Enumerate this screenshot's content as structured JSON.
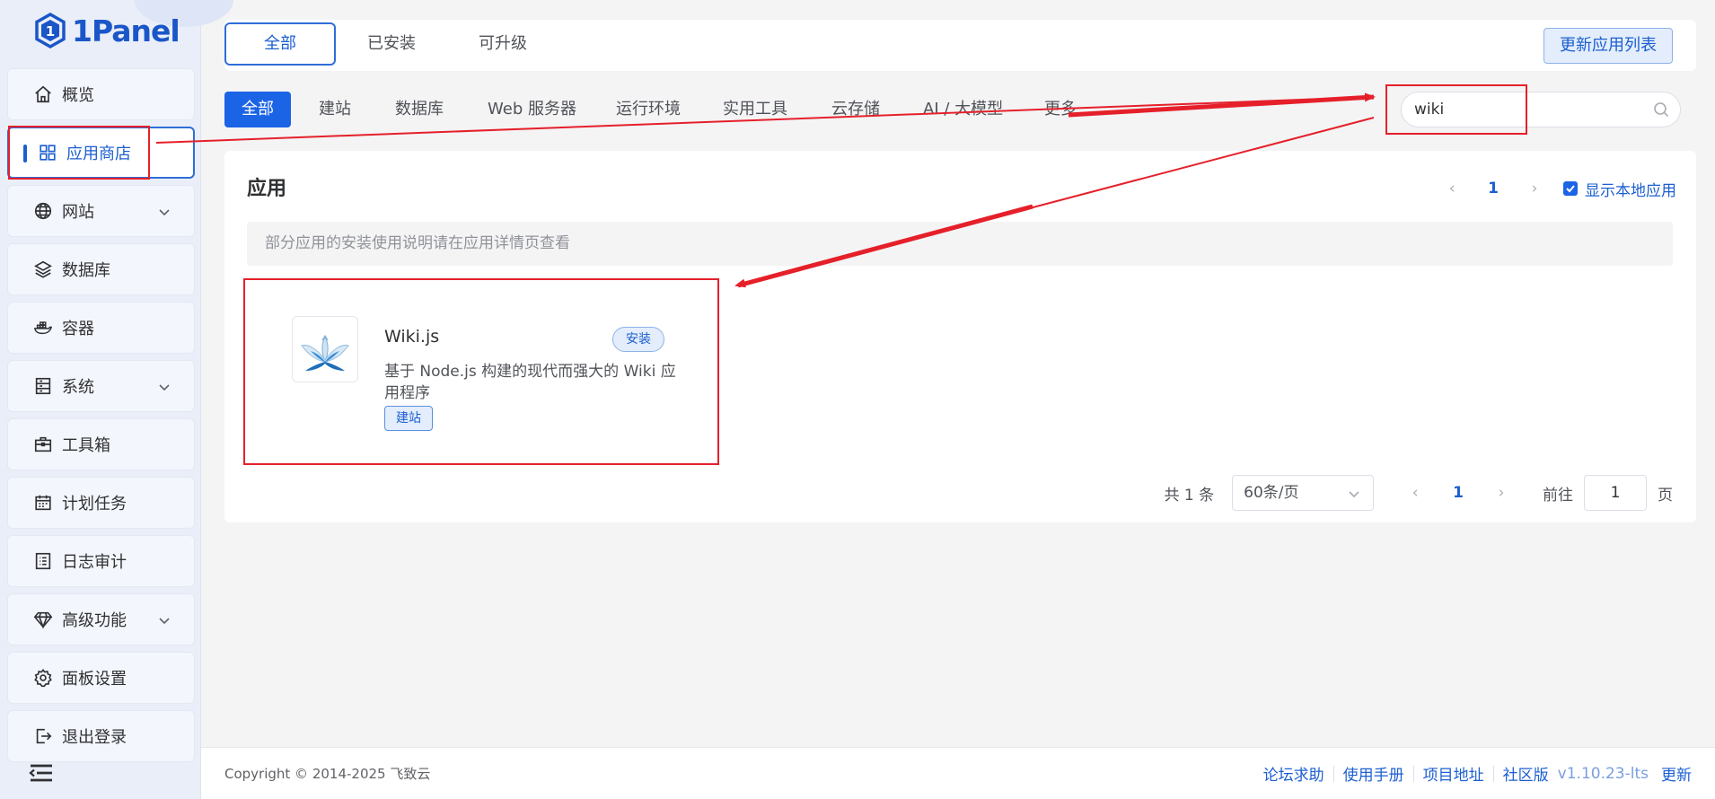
{
  "brand": {
    "name": "1Panel"
  },
  "sidebar": {
    "items": [
      {
        "label": "概览",
        "icon": "home-icon"
      },
      {
        "label": "应用商店",
        "icon": "apps-grid-icon"
      },
      {
        "label": "网站",
        "icon": "globe-icon"
      },
      {
        "label": "数据库",
        "icon": "layers-icon"
      },
      {
        "label": "容器",
        "icon": "docker-icon"
      },
      {
        "label": "系统",
        "icon": "server-icon"
      },
      {
        "label": "工具箱",
        "icon": "toolbox-icon"
      },
      {
        "label": "计划任务",
        "icon": "calendar-icon"
      },
      {
        "label": "日志审计",
        "icon": "log-icon"
      },
      {
        "label": "高级功能",
        "icon": "diamond-icon"
      },
      {
        "label": "面板设置",
        "icon": "gear-icon"
      },
      {
        "label": "退出登录",
        "icon": "logout-icon"
      }
    ]
  },
  "top_tabs": [
    "全部",
    "已安装",
    "可升级"
  ],
  "refresh_button": "更新应用列表",
  "categories": [
    "全部",
    "建站",
    "数据库",
    "Web 服务器",
    "运行环境",
    "实用工具",
    "云存储",
    "AI / 大模型",
    "更多"
  ],
  "search": {
    "value": "wiki"
  },
  "apps_section": {
    "title": "应用",
    "page": "1",
    "show_local_label": "显示本地应用",
    "notice": "部分应用的安装使用说明请在应用详情页查看"
  },
  "app": {
    "name": "Wiki.js",
    "install_label": "安装",
    "description": "基于 Node.js 构建的现代而强大的 Wiki 应用程序",
    "tag": "建站"
  },
  "pagination": {
    "total": "共 1 条",
    "page_size": "60条/页",
    "page": "1",
    "goto_label": "前往",
    "goto_value": "1",
    "page_suffix": "页"
  },
  "footer": {
    "copyright": "Copyright © 2014-2025 飞致云",
    "links": [
      "论坛求助",
      "使用手册",
      "项目地址",
      "社区版"
    ],
    "version": "v1.10.23-lts",
    "update_label": "更新"
  },
  "colors": {
    "accent": "#1c64e6",
    "annotation": "#e5202a",
    "sidebar_bg": "#e9eef8"
  }
}
